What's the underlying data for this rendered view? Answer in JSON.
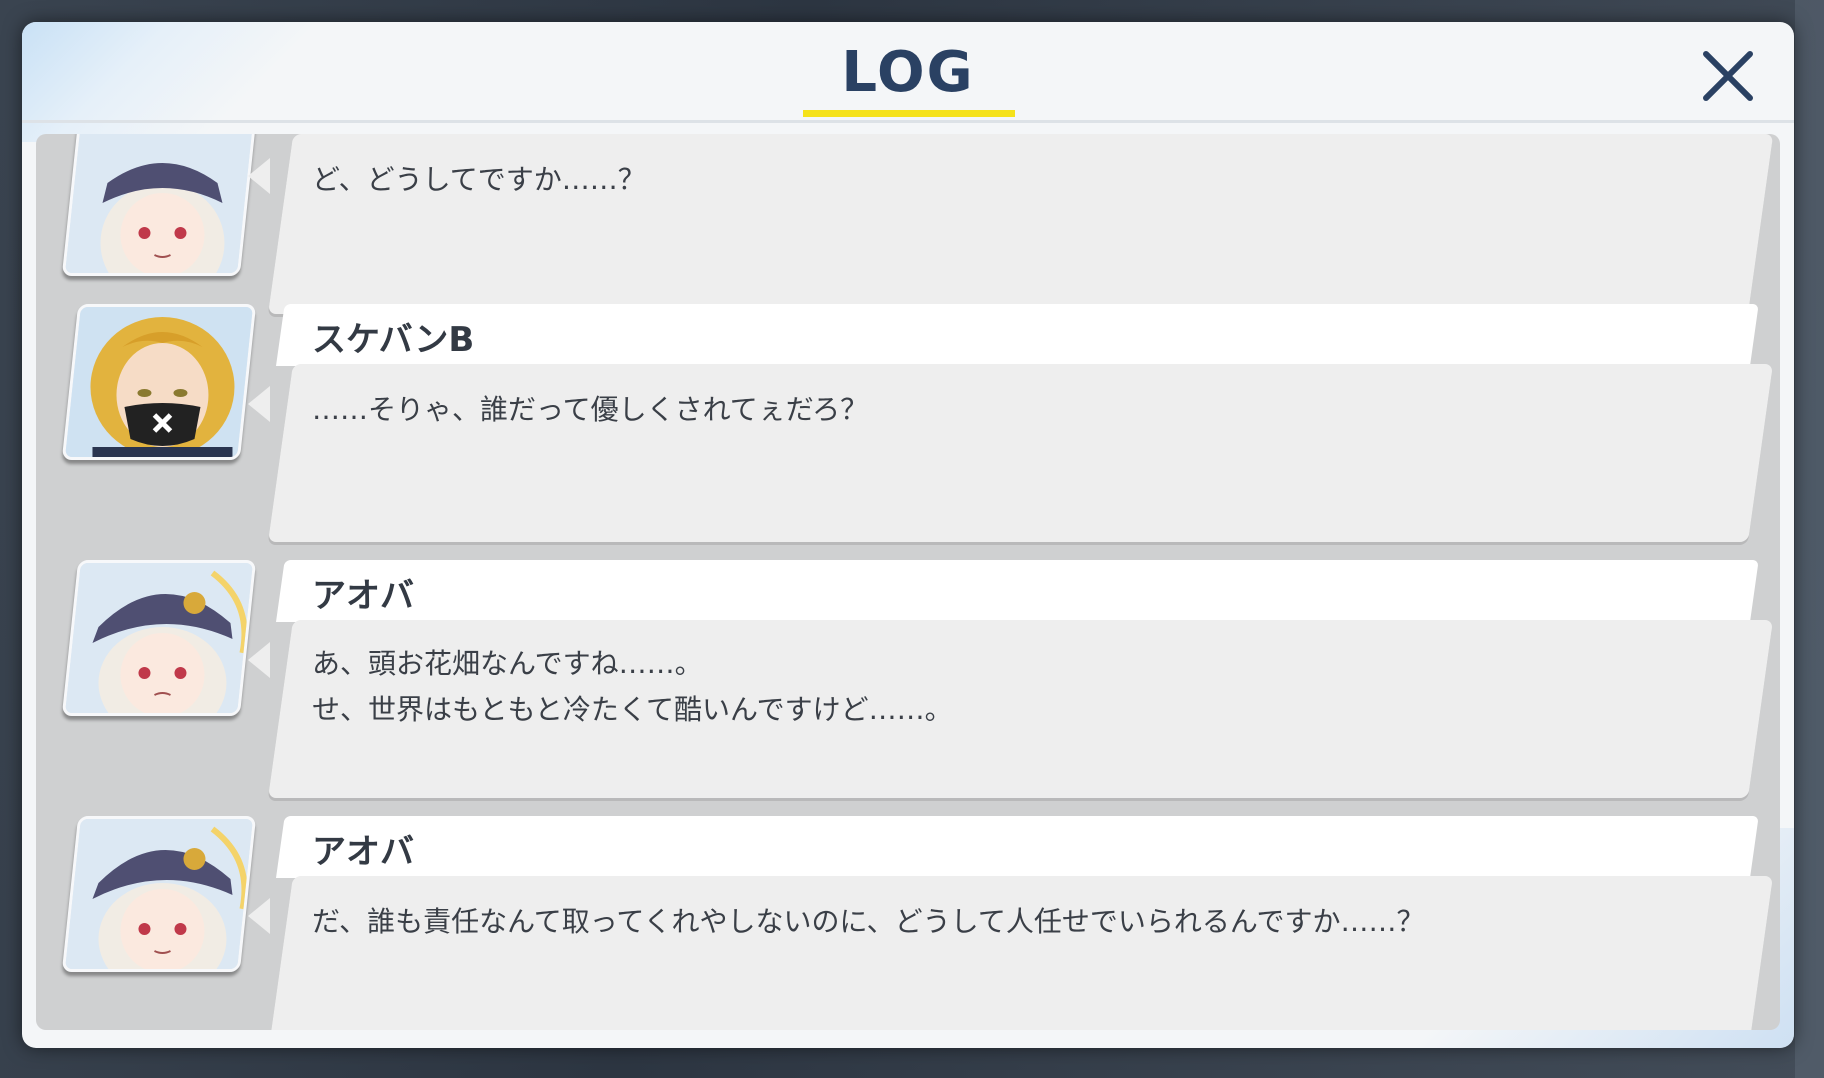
{
  "header": {
    "title": "LOG",
    "close_icon": "close-icon",
    "accent_color": "#f5e21b",
    "title_color": "#2a4163"
  },
  "entries": [
    {
      "speaker": "",
      "avatar_icon": "aoba-portrait-icon",
      "lines": [
        "ど、どうしてですか……？"
      ]
    },
    {
      "speaker": "スケバンB",
      "avatar_icon": "sukeban-portrait-icon",
      "lines": [
        "……そりゃ、誰だって優しくされてぇだろ？"
      ]
    },
    {
      "speaker": "アオバ",
      "avatar_icon": "aoba-portrait-icon",
      "lines": [
        "あ、頭お花畑なんですね……。",
        "せ、世界はもともと冷たくて酷いんですけど……。"
      ]
    },
    {
      "speaker": "アオバ",
      "avatar_icon": "aoba-portrait-icon",
      "lines": [
        "だ、誰も責任なんて取ってくれやしないのに、どうして人任せでいられるんですか……？"
      ]
    }
  ]
}
